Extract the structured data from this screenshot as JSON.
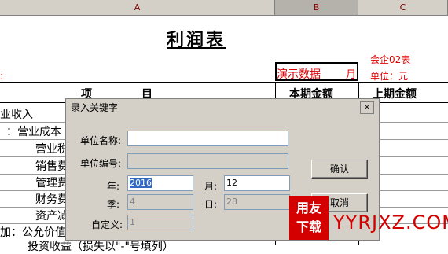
{
  "columns": [
    "A",
    "B",
    "C"
  ],
  "sheet": {
    "title": "利润表",
    "left_red_mark": ":",
    "demo_text": "演示数据",
    "month_suffix": "月",
    "report_code": "会企02表",
    "unit": "单位：元",
    "header_item": "项",
    "header_item2": "目",
    "header_current": "本期金额",
    "header_prior": "上期金额",
    "rows": [
      "业收入",
      "：营业成本",
      "营业税",
      "销售费",
      "管理费",
      "财务费",
      "资产减",
      "加：公允价值",
      "投资收益（损失以\"-\"号填列）"
    ]
  },
  "dialog": {
    "title": "录入关键字",
    "close_label": "×",
    "unit_name_label": "单位名称:",
    "unit_name_value": "",
    "unit_code_label": "单位编号:",
    "unit_code_value": "",
    "year_label": "年:",
    "year_value": "2016",
    "month_label": "月:",
    "month_value": "12",
    "quarter_label": "季:",
    "quarter_value": "4",
    "day_label": "日:",
    "day_value": "28",
    "custom_label": "自定义:",
    "custom_value": "1",
    "ok_label": "确认",
    "cancel_label": "取消"
  },
  "watermark": {
    "box_line1": "用友",
    "box_line2": "下载",
    "url": "YYRJXZ.COM"
  }
}
